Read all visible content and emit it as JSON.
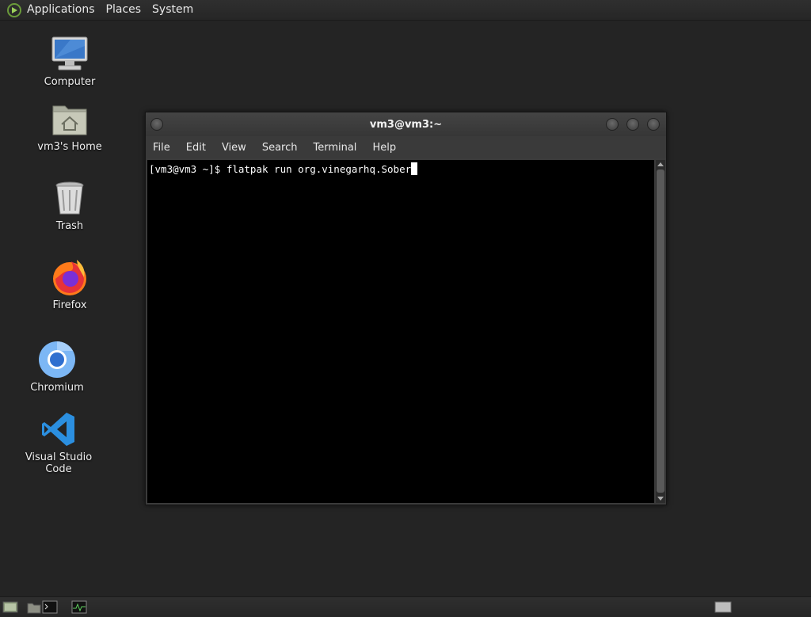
{
  "top_panel": {
    "menus": [
      "Applications",
      "Places",
      "System"
    ]
  },
  "desktop": {
    "icons": [
      {
        "label": "Computer",
        "icon": "computer-icon"
      },
      {
        "label": "vm3's Home",
        "icon": "home-folder-icon"
      },
      {
        "label": "Trash",
        "icon": "trash-icon"
      },
      {
        "label": "Firefox",
        "icon": "firefox-icon"
      },
      {
        "label": "Chromium",
        "icon": "chromium-icon"
      },
      {
        "label": "Visual Studio Code",
        "icon": "vscode-icon"
      }
    ]
  },
  "terminal": {
    "title": "vm3@vm3:~",
    "menus": [
      "File",
      "Edit",
      "View",
      "Search",
      "Terminal",
      "Help"
    ],
    "line": "[vm3@vm3 ~]$ flatpak run org.vinegarhq.Sober"
  },
  "bottom_panel": {
    "items": [
      "show-desktop-icon",
      "file-manager-icon",
      "terminal-icon",
      "system-monitor-icon",
      "workspace-switcher-icon"
    ]
  },
  "colors": {
    "desktop_bg": "#242424",
    "panel_bg": "#2a2a2a",
    "terminal_bg": "#000000",
    "vscode_blue": "#2b8fe0"
  }
}
